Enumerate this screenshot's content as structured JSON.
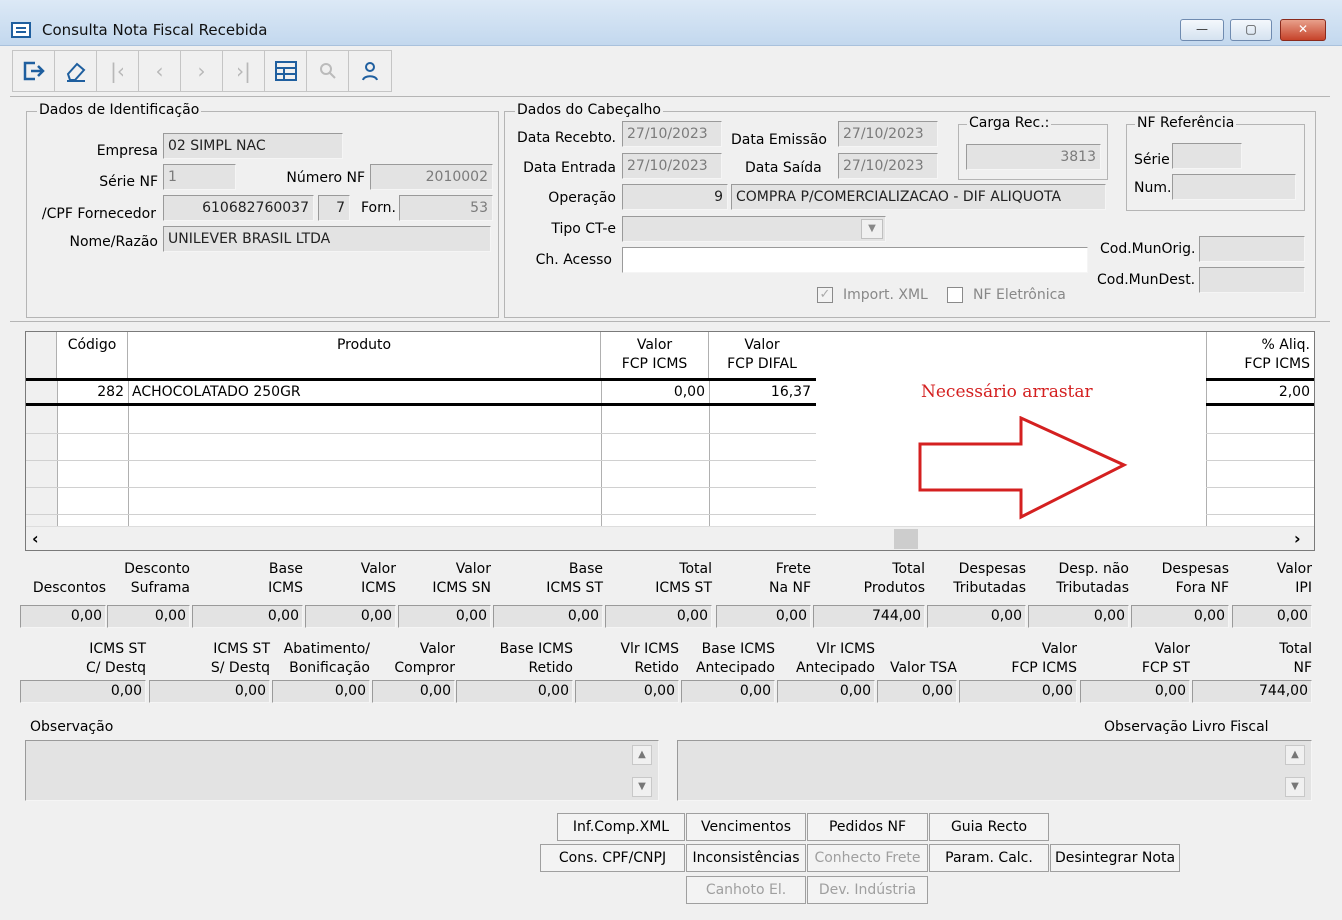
{
  "window": {
    "title": "Consulta Nota Fiscal Recebida",
    "minimize": "—",
    "maximize": "▢",
    "close": "✕"
  },
  "toolbar": {
    "icons": [
      "exit-icon",
      "eraser-icon",
      "first-record-icon",
      "previous-record-icon",
      "next-record-icon",
      "last-record-icon",
      "table-icon",
      "search-icon",
      "user-icon"
    ]
  },
  "identificacao": {
    "legend": "Dados de Identificação",
    "empresa_label": "Empresa",
    "empresa": "02 SIMPL NAC",
    "serie_label": "Série NF",
    "serie": "1",
    "numero_label": "Número NF",
    "numero": "2010002",
    "cpf_label": "/CPF Fornecedor",
    "cpf": "610682760037",
    "cpf_dv": "7",
    "forn_label": "Forn.",
    "forn": "53",
    "nome_label": "Nome/Razão",
    "nome": "UNILEVER BRASIL LTDA"
  },
  "cabecalho": {
    "legend": "Dados do Cabeçalho",
    "data_receb_label": "Data Recebto.",
    "data_receb": "27/10/2023",
    "data_emissao_label": "Data Emissão",
    "data_emissao": "27/10/2023",
    "data_entrada_label": "Data Entrada",
    "data_entrada": "27/10/2023",
    "data_saida_label": "Data Saída",
    "data_saida": "27/10/2023",
    "operacao_label": "Operação",
    "operacao_cod": "9",
    "operacao_desc": "COMPRA P/COMERCIALIZACAO - DIF ALIQUOTA",
    "tipo_cte_label": "Tipo CT-e",
    "tipo_cte": "",
    "ch_acesso_label": "Ch. Acesso",
    "ch_acesso": "",
    "carga_legend": "Carga Rec.:",
    "carga": "3813",
    "nfref_legend": "NF Referência",
    "nfref_serie_label": "Série",
    "nfref_num_label": "Num.",
    "codmunorig_label": "Cod.MunOrig.",
    "codmundest_label": "Cod.MunDest.",
    "import_xml_label": "Import. XML",
    "nf_eletronica_label": "NF Eletrônica"
  },
  "grid": {
    "headers": {
      "codigo": "Código",
      "produto": "Produto",
      "valor_fcp_icms_1": "Valor",
      "valor_fcp_icms_2": "FCP ICMS",
      "valor_fcp_difal_1": "Valor",
      "valor_fcp_difal_2": "FCP DIFAL",
      "aliq_fcp_1": "% Aliq.",
      "aliq_fcp_2": "FCP ICMS"
    },
    "row": {
      "codigo": "282",
      "produto": "ACHOCOLATADO 250GR",
      "fcp_icms": "0,00",
      "fcp_difal": "16,37",
      "aliq_fcp": "2,00"
    },
    "annotation": "Necessário arrastar",
    "annotation_color": "#d42020"
  },
  "totals1": {
    "labels": [
      [
        "",
        "Descontos"
      ],
      [
        "Desconto",
        "Suframa"
      ],
      [
        "Base",
        "ICMS"
      ],
      [
        "Valor",
        "ICMS"
      ],
      [
        "Valor",
        "ICMS SN"
      ],
      [
        "Base",
        "ICMS ST"
      ],
      [
        "Total",
        "ICMS ST"
      ],
      [
        "Frete",
        "Na NF"
      ],
      [
        "Total",
        "Produtos"
      ],
      [
        "Despesas",
        "Tributadas"
      ],
      [
        "Desp. não",
        "Tributadas"
      ],
      [
        "Despesas",
        "Fora NF"
      ],
      [
        "Valor",
        "IPI"
      ]
    ],
    "values": [
      "0,00",
      "0,00",
      "0,00",
      "0,00",
      "0,00",
      "0,00",
      "0,00",
      "0,00",
      "744,00",
      "0,00",
      "0,00",
      "0,00",
      "0,00"
    ]
  },
  "totals2": {
    "labels": [
      [
        "ICMS ST",
        "C/ Destq"
      ],
      [
        "ICMS ST",
        "S/ Destq"
      ],
      [
        "Abatimento/",
        "Bonificação"
      ],
      [
        "Valor",
        "Compror"
      ],
      [
        "Base ICMS",
        "Retido"
      ],
      [
        "Vlr ICMS",
        "Retido"
      ],
      [
        "Base ICMS",
        "Antecipado"
      ],
      [
        "Vlr ICMS",
        "Antecipado"
      ],
      [
        "",
        "Valor TSA"
      ],
      [
        "Valor",
        "FCP ICMS"
      ],
      [
        "Valor",
        "FCP ST"
      ],
      [
        "Total",
        "NF"
      ]
    ],
    "values": [
      "0,00",
      "0,00",
      "0,00",
      "0,00",
      "0,00",
      "0,00",
      "0,00",
      "0,00",
      "0,00",
      "0,00",
      "0,00",
      "744,00"
    ]
  },
  "observacao": {
    "label": "Observação",
    "livro_label": "Observação Livro Fiscal"
  },
  "buttons": {
    "inf_comp_xml": "Inf.Comp.XML",
    "vencimentos": "Vencimentos",
    "pedidos_nf": "Pedidos NF",
    "guia_recto": "Guia Recto",
    "cons_cpf": "Cons. CPF/CNPJ",
    "inconsistencias": "Inconsistências",
    "conhecto_frete": "Conhecto Frete",
    "param_calc": "Param. Calc.",
    "desintegrar": "Desintegrar Nota",
    "canhoto": "Canhoto El.",
    "dev_industria": "Dev. Indústria"
  }
}
